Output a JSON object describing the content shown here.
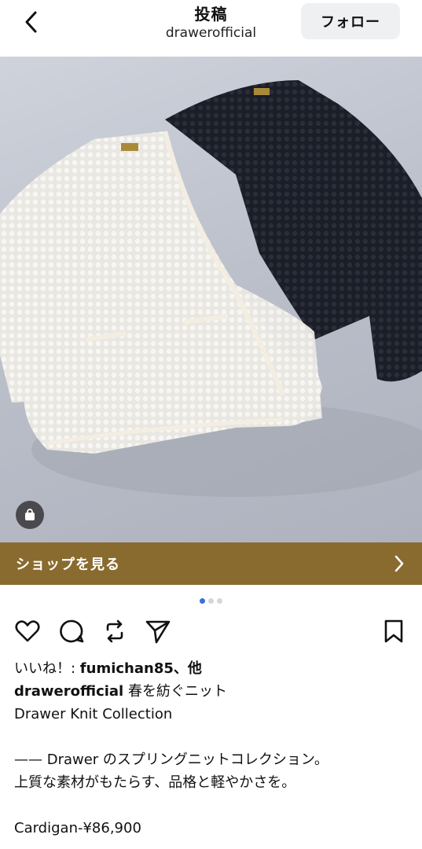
{
  "header": {
    "title": "投稿",
    "subtitle": "drawerofficial",
    "follow_label": "フォロー"
  },
  "post": {
    "shop_button_label": "ショップを見る",
    "carousel": {
      "total": 3,
      "active_index": 0
    }
  },
  "colors": {
    "shop_bar": "#8a6b2f",
    "active_dot": "#3b6fe0",
    "follow_bg": "#eef0f2"
  },
  "icons": [
    "back-icon",
    "shopping-bag-icon",
    "chevron-right-icon",
    "heart-icon",
    "comment-icon",
    "repost-icon",
    "send-icon",
    "bookmark-icon"
  ],
  "caption": {
    "likes_prefix": "いいね！: ",
    "likes_user": "fumichan85",
    "likes_suffix": "、他",
    "author": "drawerofficial",
    "headline": " 春を紡ぐニット",
    "line2": "Drawer Knit Collection",
    "line3": "—— Drawer のスプリングニットコレクション。",
    "line4": "上質な素材がもたらす、品格と軽やかさを。",
    "line5": "Cardigan-¥86,900"
  }
}
